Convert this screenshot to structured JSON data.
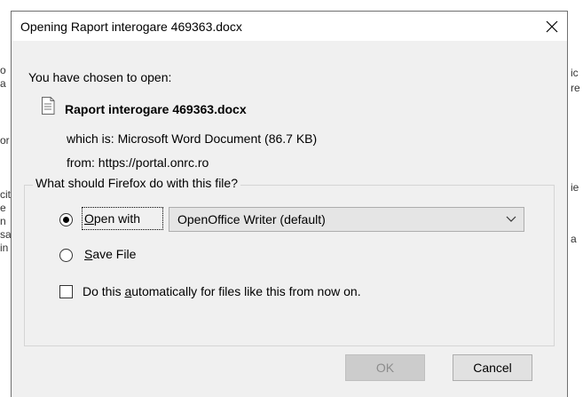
{
  "background_fragments": [
    {
      "id": "frag-l1",
      "text": "o"
    },
    {
      "id": "frag-l2",
      "text": "a"
    },
    {
      "id": "frag-l3",
      "text": "or"
    },
    {
      "id": "frag-l4",
      "text": "cit"
    },
    {
      "id": "frag-l5",
      "text": "e"
    },
    {
      "id": "frag-l6",
      "text": "n"
    },
    {
      "id": "frag-l7",
      "text": "sa"
    },
    {
      "id": "frag-l8",
      "text": "in"
    },
    {
      "id": "frag-r1",
      "text": "ic"
    },
    {
      "id": "frag-r2",
      "text": "re"
    },
    {
      "id": "frag-r3",
      "text": "ie"
    },
    {
      "id": "frag-r4",
      "text": "a"
    }
  ],
  "dialog": {
    "title": "Opening Raport interogare 469363.docx",
    "close_icon": "close-icon",
    "chosen_label": "You have chosen to open:",
    "file_icon": "document-icon",
    "file_name": "Raport interogare 469363.docx",
    "which_is": "which is:  Microsoft Word Document (86.7 KB)",
    "from": "from:  https://portal.onrc.ro",
    "question": "What should Firefox do with this file?",
    "open_with": {
      "label_accel": "O",
      "label_rest": "pen with",
      "checked": true,
      "selected_app": "OpenOffice Writer (default)"
    },
    "save_file": {
      "label_accel": "S",
      "label_rest": "ave File",
      "checked": false
    },
    "auto": {
      "label_pre": "Do this ",
      "label_accel": "a",
      "label_post": "utomatically for files like this from now on.",
      "checked": false
    },
    "ok_label": "OK",
    "ok_disabled": true,
    "cancel_label": "Cancel"
  }
}
